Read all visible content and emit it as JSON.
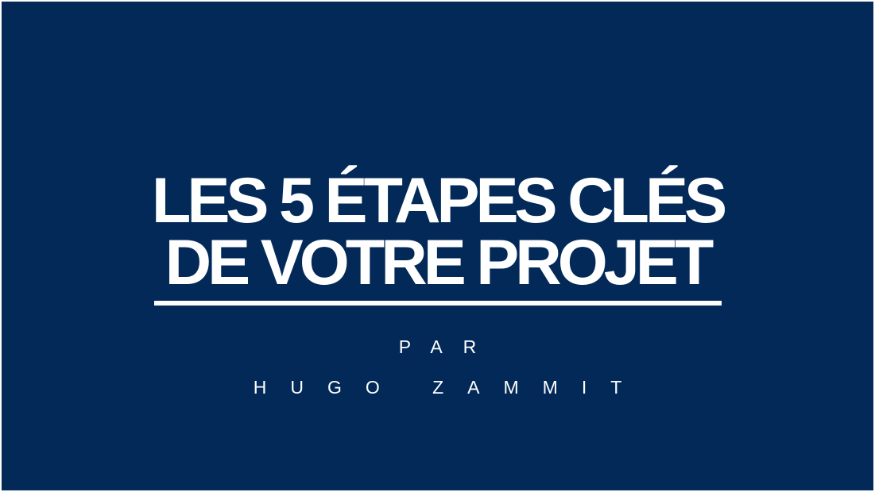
{
  "slide": {
    "background_color": "#022957",
    "title": {
      "line1": "LES 5 ÉTAPES CLÉS",
      "line2": "DE VOTRE PROJET"
    },
    "byline": {
      "prefix": "PAR",
      "author": "HUGO ZAMMIT"
    }
  }
}
